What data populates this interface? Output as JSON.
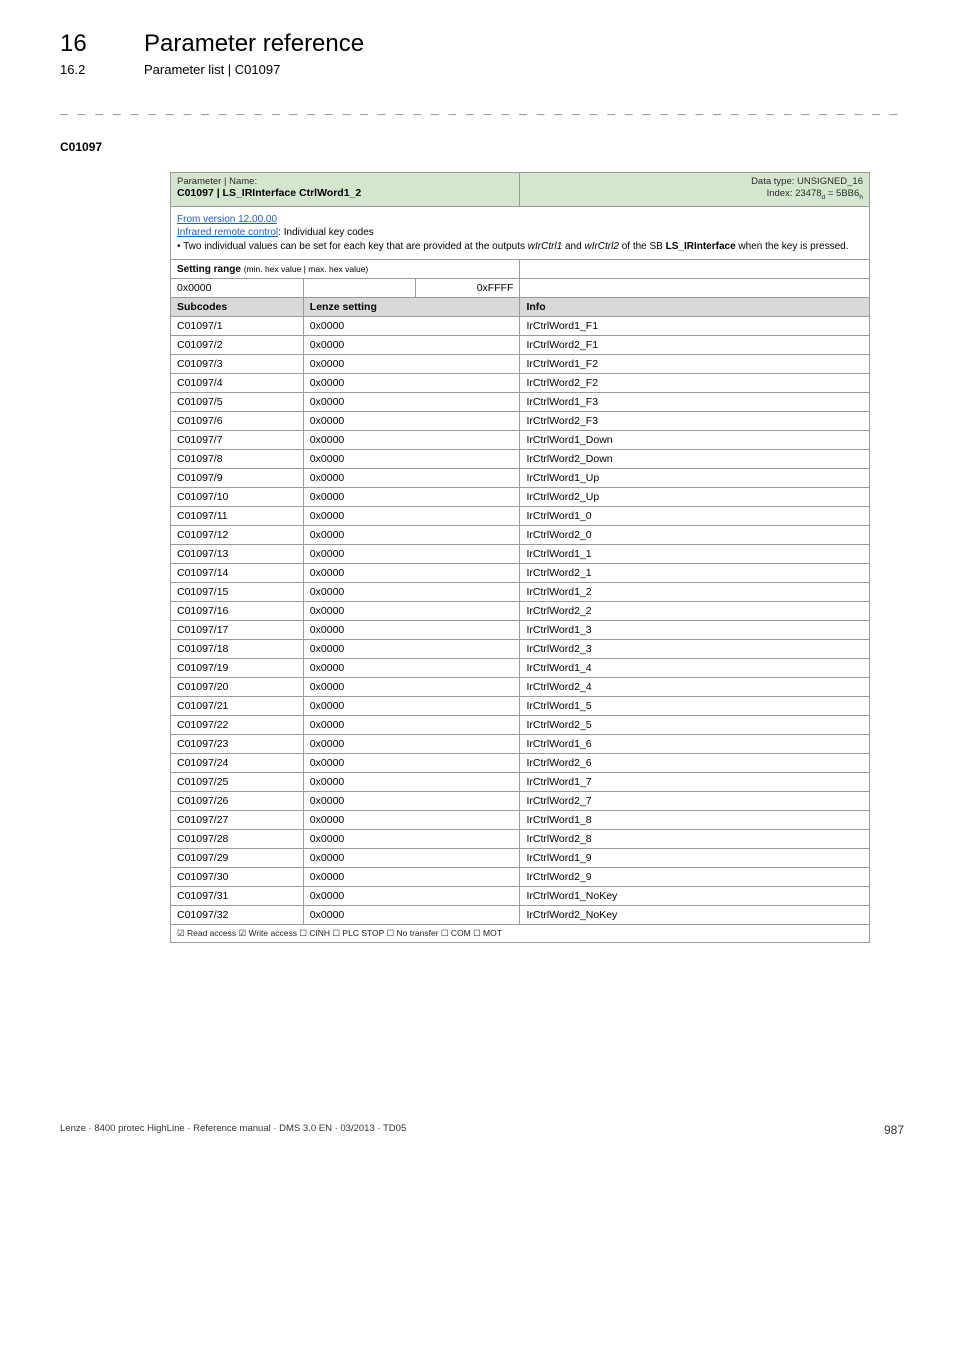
{
  "header": {
    "chapter_number": "16",
    "chapter_title": "Parameter reference",
    "section_number": "16.2",
    "section_title": "Parameter list | C01097"
  },
  "dashes": "_ _ _ _ _ _ _ _ _ _ _ _ _ _ _ _ _ _ _ _ _ _ _ _ _ _ _ _ _ _ _ _ _ _ _ _ _ _ _ _ _ _ _ _ _ _ _ _ _ _ _ _ _ _ _ _ _ _ _ _ _ _ _ _",
  "param_code": "C01097",
  "table": {
    "header_left_label": "Parameter | Name:",
    "header_left_value": "C01097 | LS_IRInterface CtrlWord1_2",
    "header_right_line1": "Data type: UNSIGNED_16",
    "header_right_line2_prefix": "Index: 23478",
    "header_right_line2_d": "d",
    "header_right_line2_mid": " = 5BB6",
    "header_right_line2_h": "h",
    "desc_version": "From version 12.00.00",
    "desc_link": "Infrared remote control",
    "desc_link_after": ": Individual key codes",
    "desc_bullet_prefix": " • Two individual values can be set for each key that are provided at the outputs ",
    "desc_bullet_i1": "wIrCtrl1",
    "desc_bullet_mid": " and ",
    "desc_bullet_i2": "wIrCtrl2",
    "desc_bullet_after": " of the SB ",
    "desc_bullet_sb": "LS_IRInterface",
    "desc_bullet_tail": " when the key is pressed.",
    "setting_range_label": "Setting range ",
    "setting_range_sub": "(min. hex value | max. hex value)",
    "min_hex": "0x0000",
    "max_hex": "0xFFFF",
    "col_subcodes": "Subcodes",
    "col_lenze": "Lenze setting",
    "col_info": "Info",
    "rows": [
      {
        "sub": "C01097/1",
        "val": "0x0000",
        "info": "IrCtrlWord1_F1"
      },
      {
        "sub": "C01097/2",
        "val": "0x0000",
        "info": "IrCtrlWord2_F1"
      },
      {
        "sub": "C01097/3",
        "val": "0x0000",
        "info": "IrCtrlWord1_F2"
      },
      {
        "sub": "C01097/4",
        "val": "0x0000",
        "info": "IrCtrlWord2_F2"
      },
      {
        "sub": "C01097/5",
        "val": "0x0000",
        "info": "IrCtrlWord1_F3"
      },
      {
        "sub": "C01097/6",
        "val": "0x0000",
        "info": "IrCtrlWord2_F3"
      },
      {
        "sub": "C01097/7",
        "val": "0x0000",
        "info": "IrCtrlWord1_Down"
      },
      {
        "sub": "C01097/8",
        "val": "0x0000",
        "info": "IrCtrlWord2_Down"
      },
      {
        "sub": "C01097/9",
        "val": "0x0000",
        "info": "IrCtrlWord1_Up"
      },
      {
        "sub": "C01097/10",
        "val": "0x0000",
        "info": "IrCtrlWord2_Up"
      },
      {
        "sub": "C01097/11",
        "val": "0x0000",
        "info": "IrCtrlWord1_0"
      },
      {
        "sub": "C01097/12",
        "val": "0x0000",
        "info": "IrCtrlWord2_0"
      },
      {
        "sub": "C01097/13",
        "val": "0x0000",
        "info": "IrCtrlWord1_1"
      },
      {
        "sub": "C01097/14",
        "val": "0x0000",
        "info": "IrCtrlWord2_1"
      },
      {
        "sub": "C01097/15",
        "val": "0x0000",
        "info": "IrCtrlWord1_2"
      },
      {
        "sub": "C01097/16",
        "val": "0x0000",
        "info": "IrCtrlWord2_2"
      },
      {
        "sub": "C01097/17",
        "val": "0x0000",
        "info": "IrCtrlWord1_3"
      },
      {
        "sub": "C01097/18",
        "val": "0x0000",
        "info": "IrCtrlWord2_3"
      },
      {
        "sub": "C01097/19",
        "val": "0x0000",
        "info": "IrCtrlWord1_4"
      },
      {
        "sub": "C01097/20",
        "val": "0x0000",
        "info": "IrCtrlWord2_4"
      },
      {
        "sub": "C01097/21",
        "val": "0x0000",
        "info": "IrCtrlWord1_5"
      },
      {
        "sub": "C01097/22",
        "val": "0x0000",
        "info": "IrCtrlWord2_5"
      },
      {
        "sub": "C01097/23",
        "val": "0x0000",
        "info": "IrCtrlWord1_6"
      },
      {
        "sub": "C01097/24",
        "val": "0x0000",
        "info": "IrCtrlWord2_6"
      },
      {
        "sub": "C01097/25",
        "val": "0x0000",
        "info": "IrCtrlWord1_7"
      },
      {
        "sub": "C01097/26",
        "val": "0x0000",
        "info": "IrCtrlWord2_7"
      },
      {
        "sub": "C01097/27",
        "val": "0x0000",
        "info": "IrCtrlWord1_8"
      },
      {
        "sub": "C01097/28",
        "val": "0x0000",
        "info": "IrCtrlWord2_8"
      },
      {
        "sub": "C01097/29",
        "val": "0x0000",
        "info": "IrCtrlWord1_9"
      },
      {
        "sub": "C01097/30",
        "val": "0x0000",
        "info": "IrCtrlWord2_9"
      },
      {
        "sub": "C01097/31",
        "val": "0x0000",
        "info": "IrCtrlWord1_NoKey"
      },
      {
        "sub": "C01097/32",
        "val": "0x0000",
        "info": "IrCtrlWord2_NoKey"
      }
    ],
    "footer_access": "☑ Read access   ☑ Write access   ☐ CINH   ☐ PLC STOP   ☐ No transfer   ☐ COM   ☐ MOT"
  },
  "footer": {
    "left": "Lenze · 8400 protec HighLine · Reference manual · DMS 3.0 EN · 03/2013 · TD05",
    "page": "987"
  }
}
